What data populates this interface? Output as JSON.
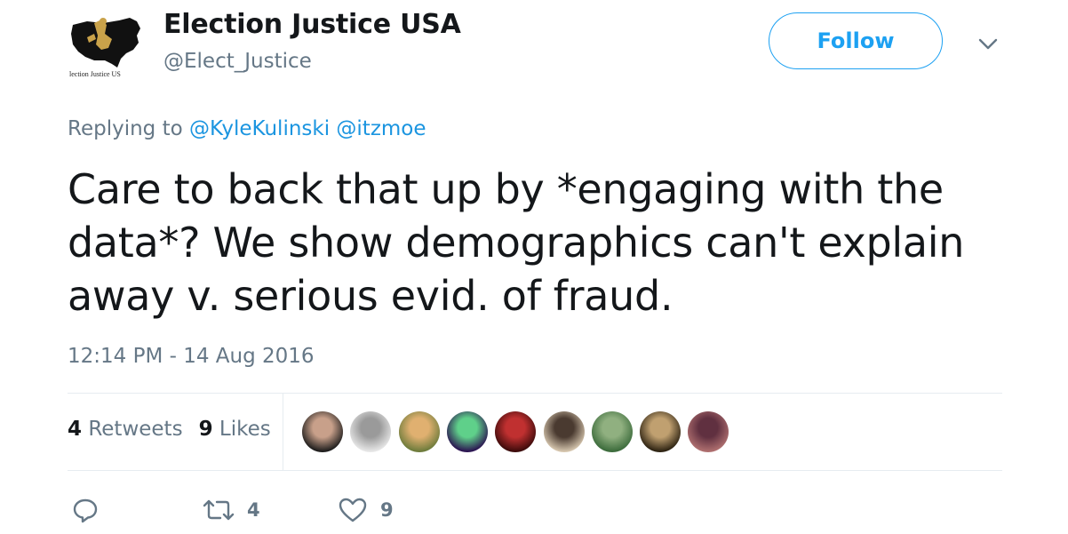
{
  "author": {
    "display_name": "Election Justice USA",
    "handle": "@Elect_Justice",
    "avatar_icon": "election-justice-logo",
    "avatar_text": "lection Justice US"
  },
  "follow_button": {
    "label": "Follow",
    "color": "#1da1f2"
  },
  "menu": {
    "icon": "chevron-down-icon"
  },
  "reply_context": {
    "prefix": "Replying to",
    "mentions": [
      "@KyleKulinski",
      "@itzmoe"
    ]
  },
  "tweet": {
    "text_lines": [
      "Care to back that up by *engaging with the",
      "data*? We show demographics can't explain",
      "away v. serious evid. of fraud."
    ],
    "timestamp": "12:14 PM - 14 Aug 2016"
  },
  "stats": {
    "retweets_count": "4",
    "retweets_label": "Retweets",
    "likes_count": "9",
    "likes_label": "Likes"
  },
  "likers": [
    {
      "name": "liker-1",
      "colors": [
        "#1a1a1a",
        "#c8a08a"
      ]
    },
    {
      "name": "liker-2",
      "colors": [
        "#e8e8e8",
        "#9a9a9a"
      ]
    },
    {
      "name": "liker-3",
      "colors": [
        "#6b7a3a",
        "#e0b070"
      ]
    },
    {
      "name": "liker-4",
      "colors": [
        "#2a1050",
        "#5fd08a"
      ]
    },
    {
      "name": "liker-5",
      "colors": [
        "#3a0a0a",
        "#c03030"
      ]
    },
    {
      "name": "liker-6",
      "colors": [
        "#d8c8b0",
        "#4a3a30"
      ]
    },
    {
      "name": "liker-7",
      "colors": [
        "#3a6a3a",
        "#90b080"
      ]
    },
    {
      "name": "liker-8",
      "colors": [
        "#2a2010",
        "#c0a070"
      ]
    },
    {
      "name": "liker-9",
      "colors": [
        "#b07070",
        "#603040"
      ]
    }
  ],
  "actions": {
    "reply_icon": "reply-icon",
    "retweet_icon": "retweet-icon",
    "retweet_count": "4",
    "like_icon": "heart-icon",
    "like_count": "9",
    "icon_color": "#657786"
  }
}
